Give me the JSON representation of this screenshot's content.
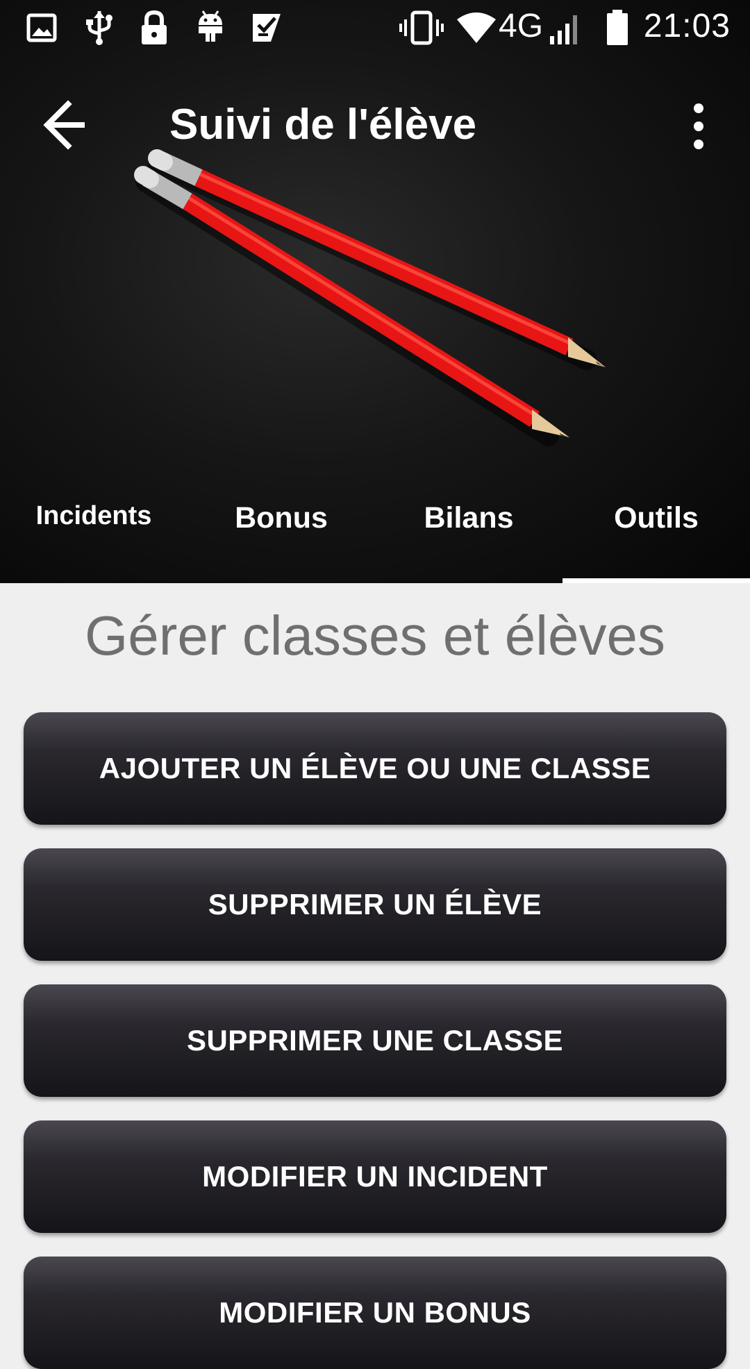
{
  "status_bar": {
    "network": "4G",
    "time": "21:03",
    "icons": [
      "image-icon",
      "usb-icon",
      "lock-icon",
      "android-icon",
      "checklist-icon",
      "vibrate-icon",
      "wifi-icon",
      "signal-icon",
      "battery-icon"
    ]
  },
  "toolbar": {
    "title": "Suivi de l'élève",
    "back_icon": "arrow-left-icon",
    "menu_icon": "more-vert-icon"
  },
  "tabs": {
    "items": [
      {
        "label": "Incidents"
      },
      {
        "label": "Bonus"
      },
      {
        "label": "Bilans"
      },
      {
        "label": "Outils"
      }
    ],
    "selected": "Outils"
  },
  "main": {
    "section_title": "Gérer classes et élèves",
    "buttons": [
      {
        "label": "AJOUTER UN ÉLÈVE OU UNE CLASSE"
      },
      {
        "label": "SUPPRIMER UN ÉLÈVE"
      },
      {
        "label": "SUPPRIMER UNE CLASSE"
      },
      {
        "label": "MODIFIER UN INCIDENT"
      },
      {
        "label": "MODIFIER UN BONUS"
      }
    ]
  },
  "colors": {
    "header_bg": "#0c0c0c",
    "page_bg": "#efefef",
    "button_bg": "#221f26",
    "title_gray": "#6f6f6f",
    "pencil_red": "#e81515"
  }
}
